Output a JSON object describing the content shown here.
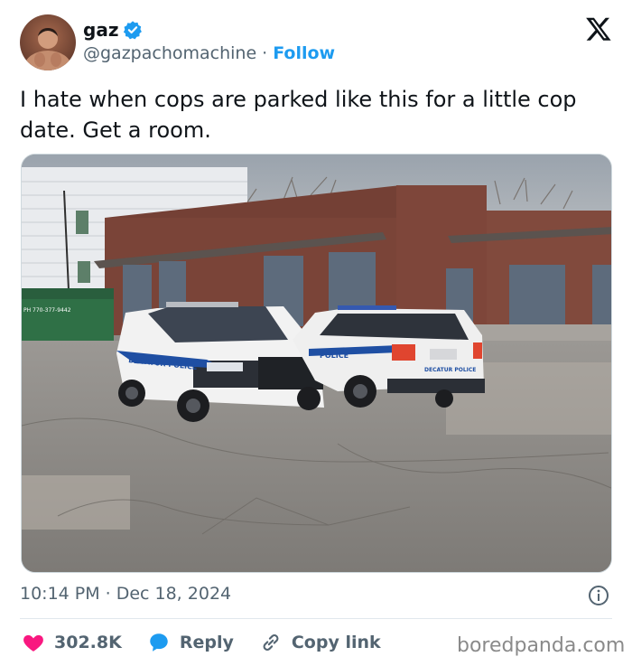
{
  "tweet": {
    "author": {
      "display_name": "gaz",
      "handle": "@gazpachomachine",
      "separator": "·",
      "follow_label": "Follow",
      "verified": true
    },
    "text": "I hate when cops are parked like this for a little cop date. Get a room.",
    "time": "10:14 PM",
    "date_separator": "·",
    "date": "Dec 18, 2024",
    "media": {
      "dumpster_text": "PH 770-377-9442",
      "car_door_text_1": "DECATUR POLICE",
      "car_door_text_2": "POLICE",
      "car_rear_text": "DECATUR POLICE"
    }
  },
  "actions": {
    "likes": "302.8K",
    "reply_label": "Reply",
    "copy_link_label": "Copy link"
  },
  "watermark": "boredpanda.com",
  "colors": {
    "accent": "#1d9bf0",
    "heart": "#f91880",
    "secondary_text": "#536471"
  },
  "icons": [
    "verified-badge-icon",
    "x-logo-icon",
    "info-icon",
    "heart-icon",
    "reply-icon",
    "link-icon"
  ]
}
